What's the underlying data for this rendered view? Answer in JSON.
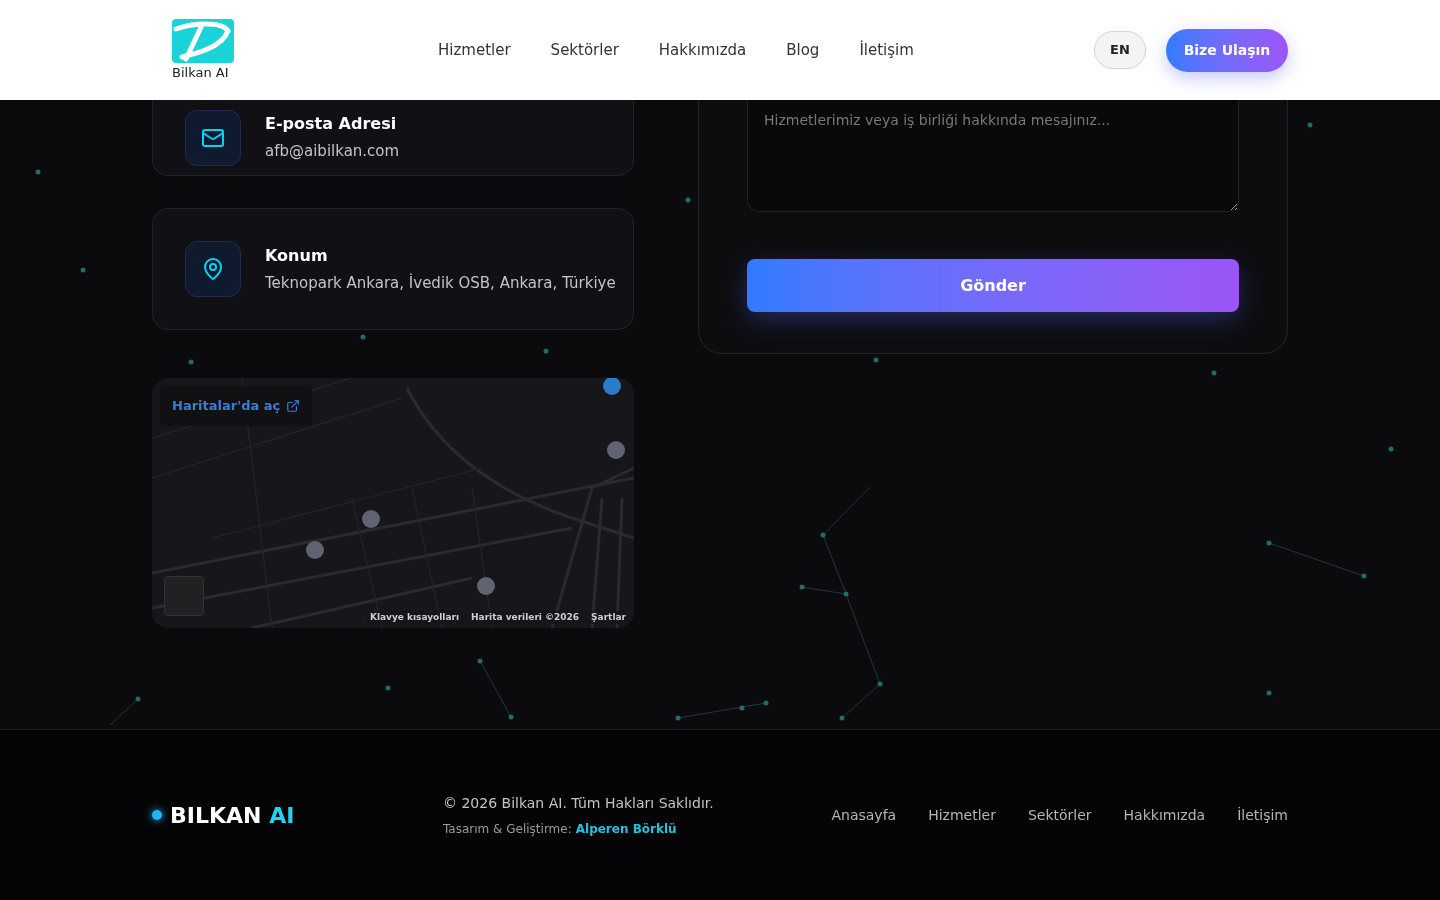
{
  "header": {
    "logo_text": "Bilkan AI",
    "nav": [
      {
        "label": "Hizmetler"
      },
      {
        "label": "Sektörler"
      },
      {
        "label": "Hakkımızda"
      },
      {
        "label": "Blog"
      },
      {
        "label": "İletişim"
      }
    ],
    "language": "EN",
    "cta": "Bize Ulaşın"
  },
  "contact_cards": [
    {
      "kind": "email",
      "title": "E-posta Adresi",
      "value": "afb@aibilkan.com"
    },
    {
      "kind": "location",
      "title": "Konum",
      "value": "Teknopark Ankara, İvedik OSB, Ankara, Türkiye"
    }
  ],
  "map": {
    "open_link": "Haritalar'da aç",
    "attribution": [
      "Klavye kısayolları",
      "Harita verileri ©2026",
      "Şartlar"
    ]
  },
  "form": {
    "message_placeholder": "Hizmetlerimiz veya iş birliği hakkında mesajınız...",
    "submit": "Gönder"
  },
  "footer": {
    "brand": "BILKAN",
    "brand_accent": "AI",
    "copyright": "© 2026 Bilkan AI. Tüm Hakları Saklıdır.",
    "credit_label": "Tasarım & Geliştirme:",
    "credit_name": "Alperen Börklü",
    "links": [
      {
        "label": "Anasayfa"
      },
      {
        "label": "Hizmetler"
      },
      {
        "label": "Sektörler"
      },
      {
        "label": "Hakkımızda"
      },
      {
        "label": "İletişim"
      }
    ]
  }
}
